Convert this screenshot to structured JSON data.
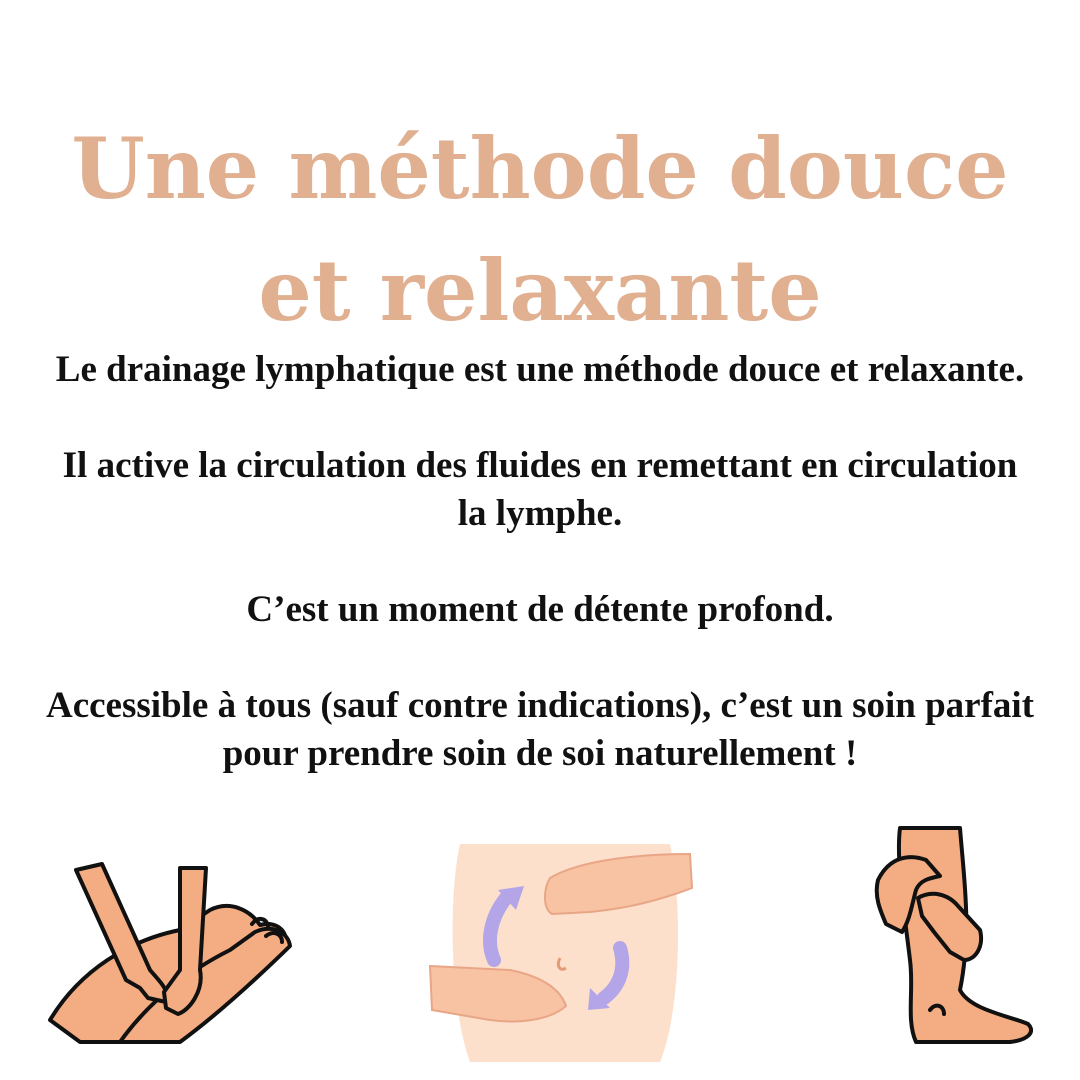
{
  "title": {
    "line1": "Une méthode douce",
    "line2": "et relaxante"
  },
  "paragraphs": [
    {
      "lines": [
        "Le drainage lymphatique est une méthode douce et relaxante."
      ]
    },
    {
      "lines": [
        "Il active la circulation des fluides en remettant en circulation",
        "la lymphe."
      ]
    },
    {
      "lines": [
        "C’est un moment de détente profond."
      ]
    },
    {
      "lines": [
        "Accessible à tous (sauf contre indications), c’est un soin parfait",
        "pour prendre soin de soi naturellement !"
      ]
    }
  ],
  "illustrations": [
    {
      "icon": "legs-massage-icon"
    },
    {
      "icon": "belly-massage-icon"
    },
    {
      "icon": "calf-massage-icon"
    }
  ],
  "colors": {
    "title": "#e0b091",
    "text": "#111111",
    "skin": "#f4ad82",
    "arrows": "#b3a5e8"
  }
}
